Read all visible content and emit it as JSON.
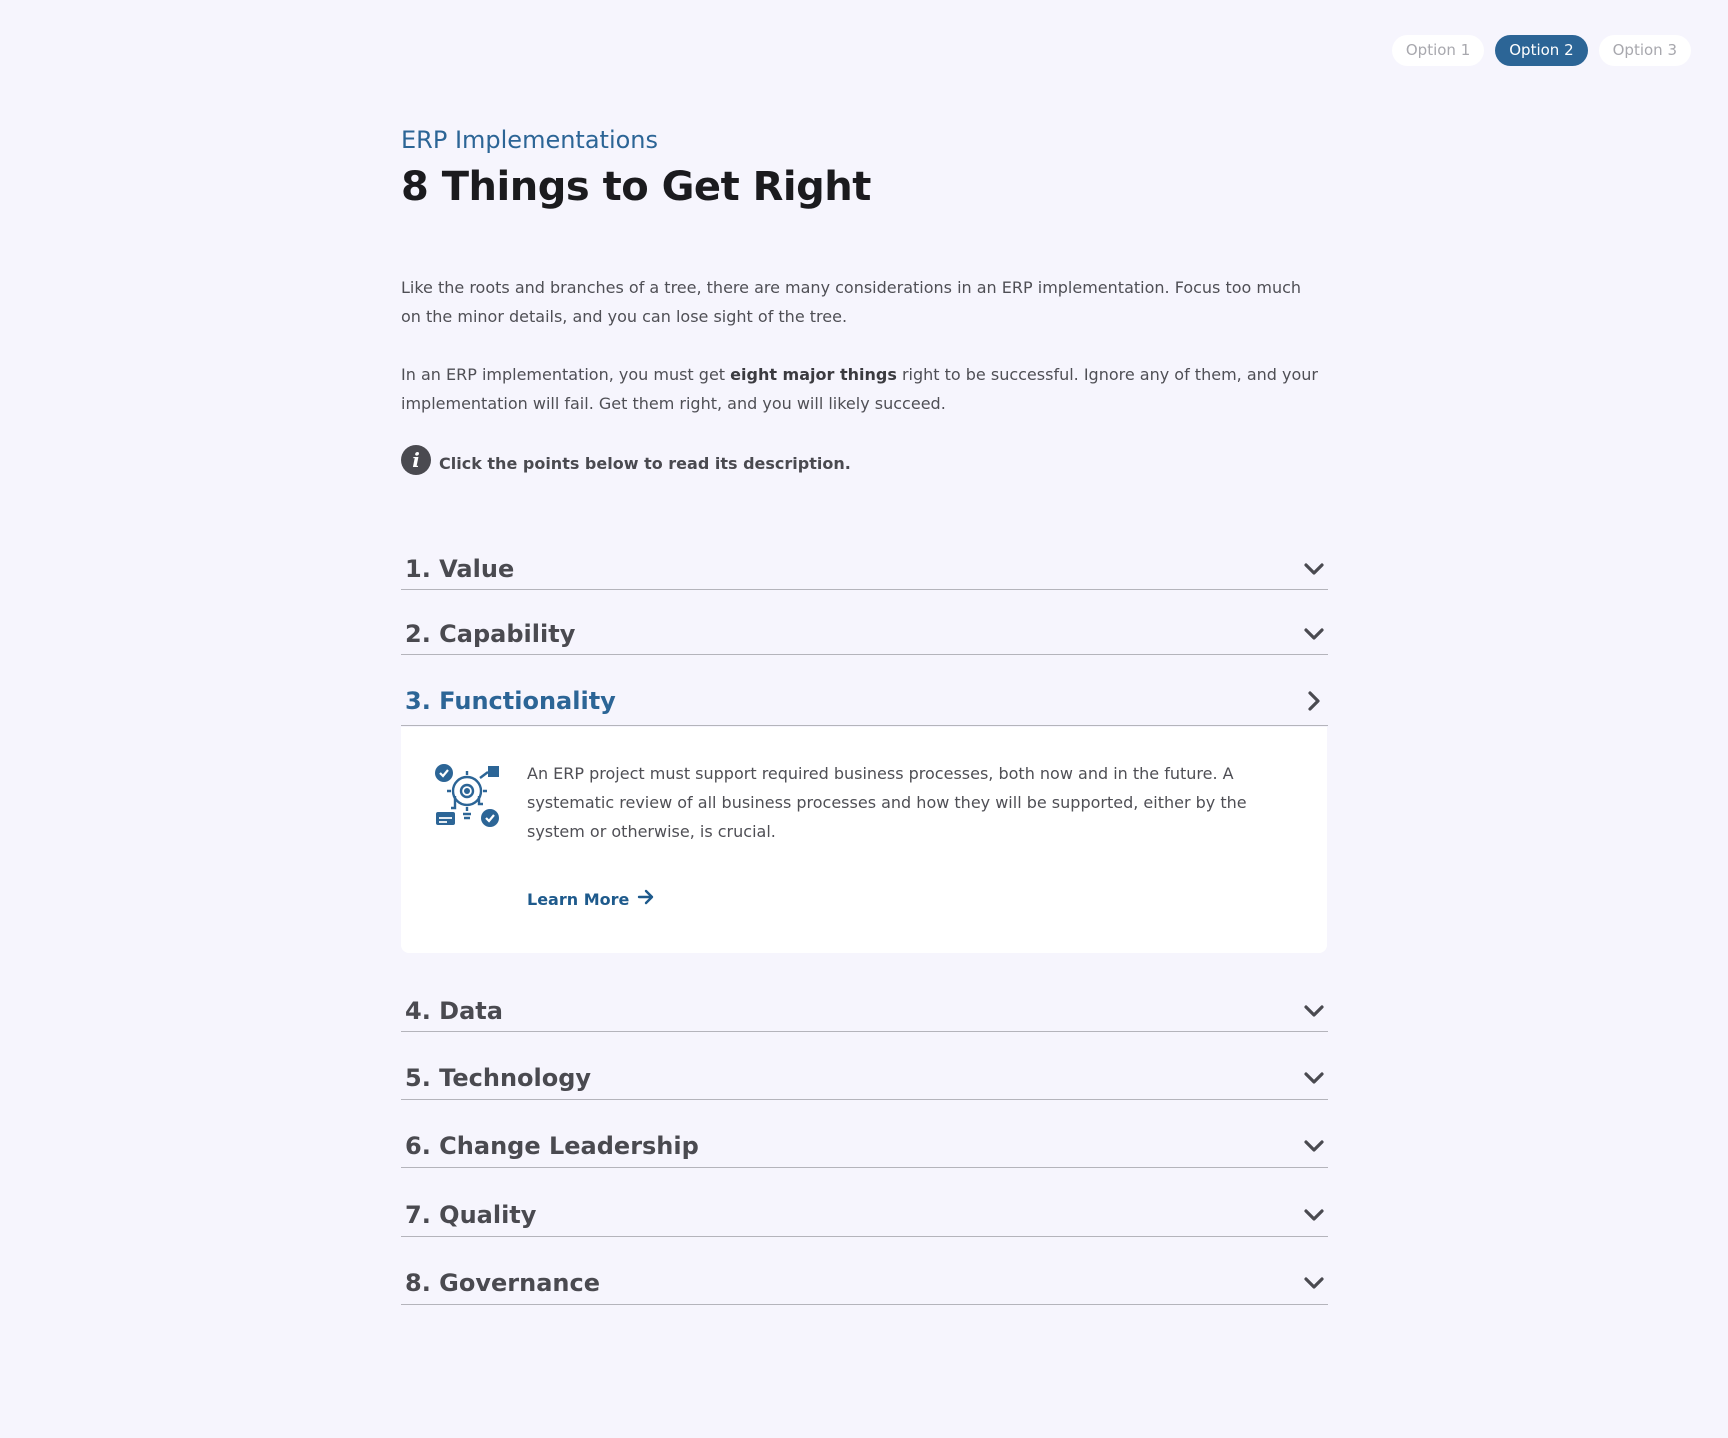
{
  "options": [
    "Option 1",
    "Option 2",
    "Option 3"
  ],
  "header": {
    "eyebrow": "ERP Implementations",
    "title": "8 Things to Get Right"
  },
  "intro": {
    "p1": "Like the roots and branches of a tree, there are many considerations in an ERP implementation. Focus too much on the minor details, and you can lose sight of the tree.",
    "p2_before": "In an ERP implementation, you must get ",
    "p2_bold": "eight major things",
    "p2_after": " right to be successful. Ignore any of them, and your implementation will fail. Get them right, and you will likely succeed."
  },
  "hint": {
    "icon_glyph": "i",
    "text": "Click the points below to read its description."
  },
  "accordion": {
    "items": [
      {
        "label": "1. Value"
      },
      {
        "label": "2. Capability"
      },
      {
        "label": "3. Functionality"
      },
      {
        "label": "4. Data"
      },
      {
        "label": "5. Technology"
      },
      {
        "label": "6. Change Leadership"
      },
      {
        "label": "7. Quality"
      },
      {
        "label": "8. Governance"
      }
    ],
    "expanded": {
      "description": "An ERP project must support required business processes, both now and in the future. A systematic review of all business processes and how they will be supported, either by the system or otherwise, is crucial.",
      "learn_more": "Learn More"
    }
  },
  "colors": {
    "accent": "#2c6596",
    "background": "#f6f5fd",
    "heading": "#1b1b1e",
    "text": "#4a4a50"
  }
}
